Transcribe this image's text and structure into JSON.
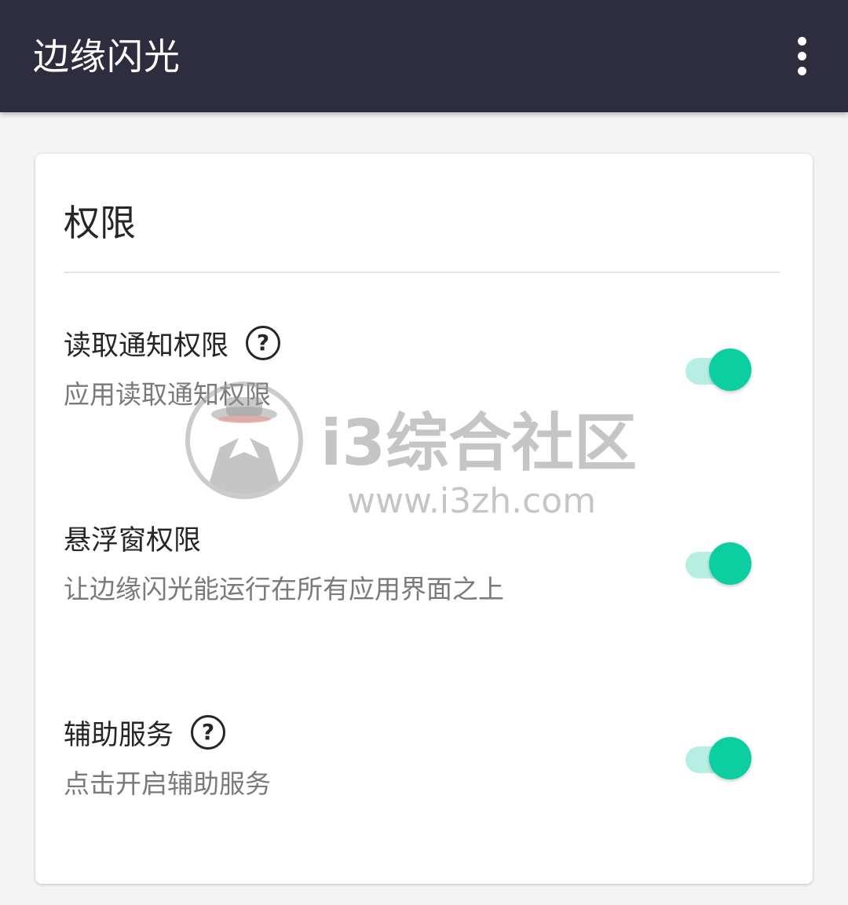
{
  "appbar": {
    "title": "边缘闪光",
    "overflow_icon": "more-vert-icon",
    "background": "#2e2d3f"
  },
  "card": {
    "title": "权限",
    "items": [
      {
        "title": "读取通知权限",
        "subtitle": "应用读取通知权限",
        "has_help": true,
        "help_glyph": "?",
        "enabled": true
      },
      {
        "title": "悬浮窗权限",
        "subtitle": "让边缘闪光能运行在所有应用界面之上",
        "has_help": false,
        "enabled": true
      },
      {
        "title": "辅助服务",
        "subtitle": "点击开启辅助服务",
        "has_help": true,
        "help_glyph": "?",
        "enabled": true
      }
    ]
  },
  "colors": {
    "accent": "#0ccfa1",
    "track": "#b6efe1",
    "text_primary": "#262626",
    "text_secondary": "#7a7a7a"
  },
  "watermark": {
    "title": "i3综合社区",
    "url": "www.i3zh.com"
  }
}
